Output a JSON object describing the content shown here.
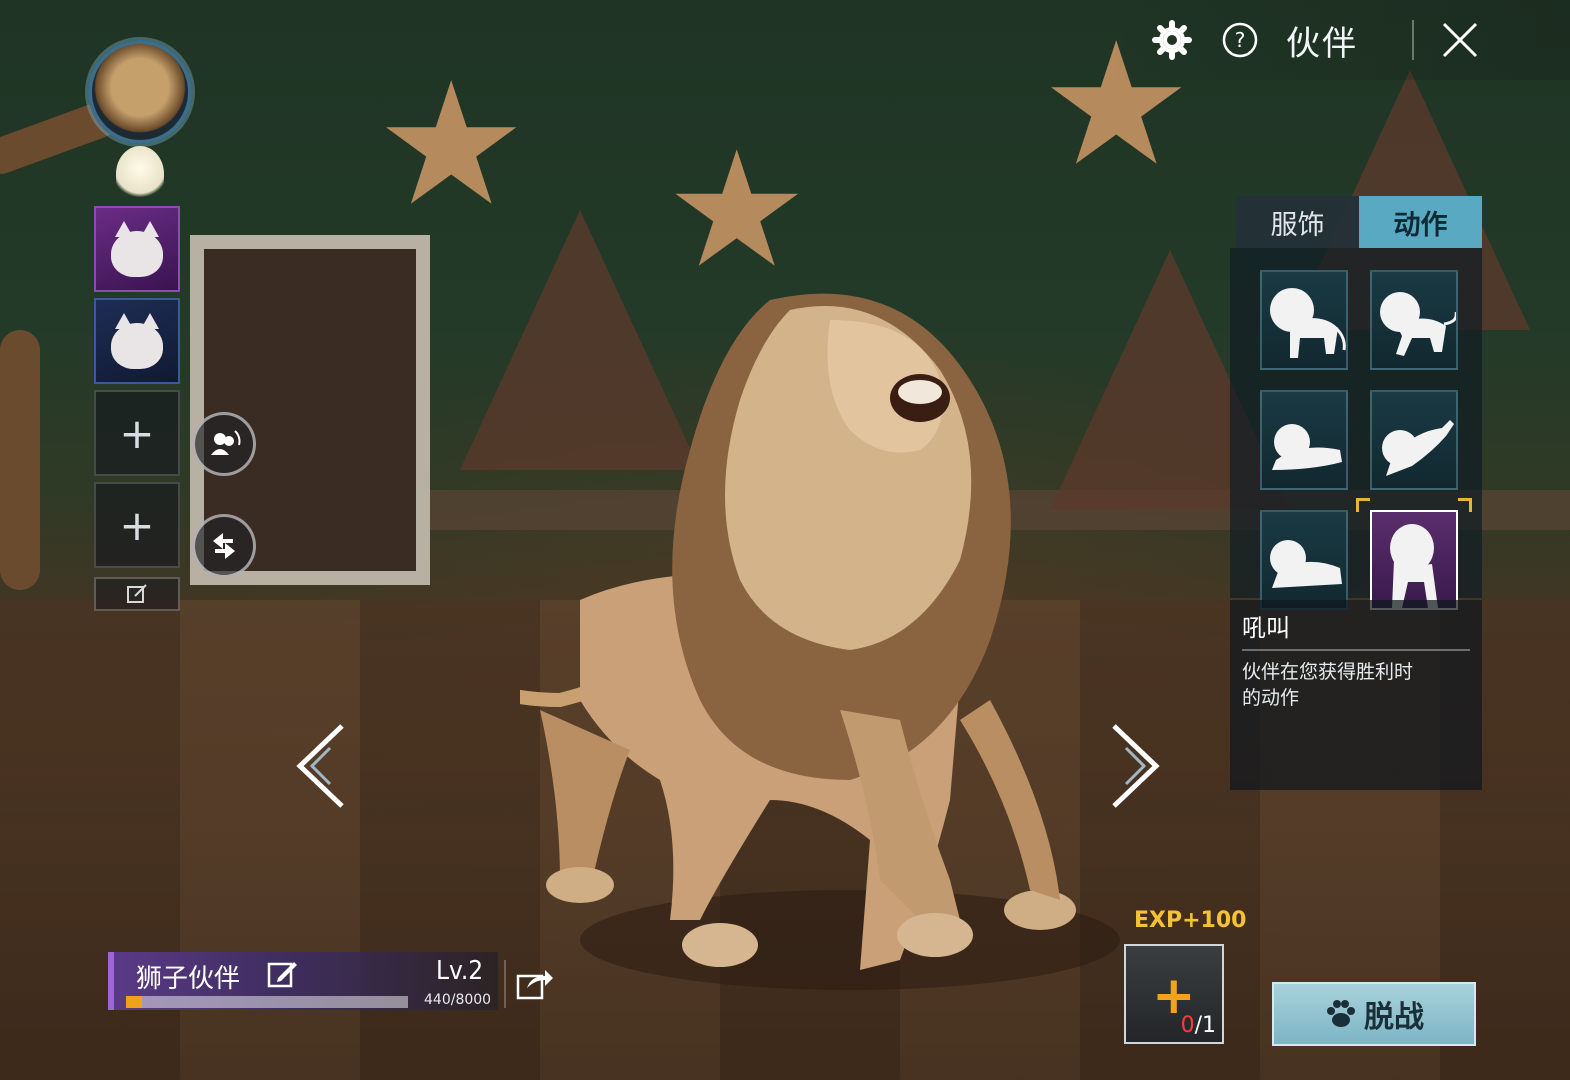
{
  "topbar": {
    "title": "伙伴",
    "settings_icon": "gear-icon",
    "help_icon": "question-circle-icon",
    "close_icon": "close-icon"
  },
  "left_column": {
    "avatar_icon": "lion-avatar-icon",
    "slots": [
      {
        "type": "pet",
        "color": "#6a2c86",
        "icon": "cat-pet-icon"
      },
      {
        "type": "pet",
        "color": "#1e2d56",
        "icon": "cat-pet-icon"
      },
      {
        "type": "empty",
        "label": "+"
      },
      {
        "type": "empty",
        "label": "+"
      }
    ],
    "edit_icon": "edit-icon",
    "swap_buttons": [
      "swap-pets-icon",
      "swap-position-icon"
    ]
  },
  "panel": {
    "tabs": [
      {
        "label": "服饰",
        "active": false
      },
      {
        "label": "动作",
        "active": true
      }
    ],
    "actions": [
      {
        "icon": "lion-stand-icon",
        "selected": false
      },
      {
        "icon": "lion-walk-icon",
        "selected": false
      },
      {
        "icon": "lion-lie-icon",
        "selected": false
      },
      {
        "icon": "lion-pounce-icon",
        "selected": false
      },
      {
        "icon": "lion-crouch-icon",
        "selected": false
      },
      {
        "icon": "lion-roar-icon",
        "selected": true
      }
    ],
    "description": {
      "title": "吼叫",
      "text_line1": "伙伴在您获得胜利时",
      "text_line2": "的动作"
    }
  },
  "pet_info": {
    "name": "狮子伙伴",
    "level": "Lv.2",
    "exp_text": "440/8000",
    "exp_current": 440,
    "exp_max": 8000,
    "exp_color": "#f0a21a",
    "share_icon": "share-icon"
  },
  "food": {
    "exp_bonus": "EXP+100",
    "count_zero": "0",
    "count_rest": "/1"
  },
  "dismiss_button": {
    "label": "脱战",
    "icon": "paw-icon"
  },
  "nav": {
    "prev_icon": "chevron-left-icon",
    "next_icon": "chevron-right-icon"
  }
}
